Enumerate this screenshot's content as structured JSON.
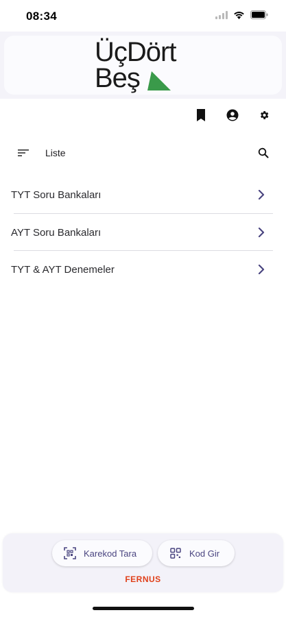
{
  "status_bar": {
    "time": "08:34",
    "icons": [
      "signal-icon",
      "wifi-icon",
      "battery-icon"
    ]
  },
  "header": {
    "logo_line1": "ÜçDört",
    "logo_line2": "Beş",
    "logo_accent_color": "#3a9a4a",
    "actions": [
      {
        "name": "bookmark-icon"
      },
      {
        "name": "account-icon"
      },
      {
        "name": "settings-icon"
      }
    ]
  },
  "list_header": {
    "title": "Liste",
    "filter_icon": "filter-icon",
    "search_icon": "search-icon"
  },
  "menu": {
    "items": [
      {
        "label": "TYT Soru Bankaları"
      },
      {
        "label": "AYT Soru Bankaları"
      },
      {
        "label": "TYT & AYT Denemeler"
      }
    ],
    "chevron_color": "#4a4580"
  },
  "bottom_bar": {
    "scan_label": "Karekod Tara",
    "code_label": "Kod Gir",
    "brand": "FERNUS",
    "brand_color": "#e0401a"
  }
}
